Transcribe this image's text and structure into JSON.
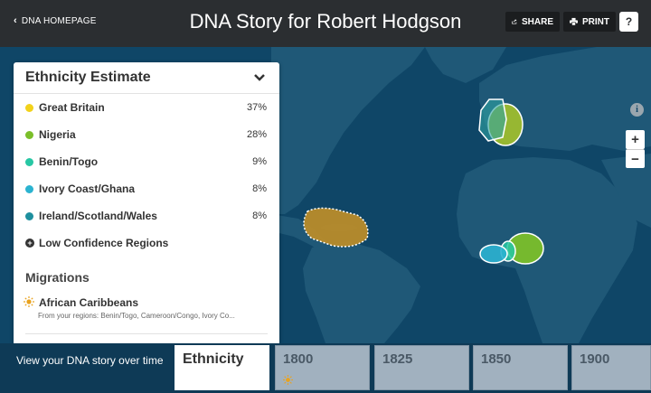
{
  "header": {
    "back_label": "DNA HOMEPAGE",
    "title": "DNA Story for Robert Hodgson",
    "share_label": "SHARE",
    "print_label": "PRINT",
    "help_label": "?"
  },
  "panel": {
    "title": "Ethnicity Estimate",
    "ethnicities": [
      {
        "name": "Great Britain",
        "percent": "37%",
        "color": "#f2d21b"
      },
      {
        "name": "Nigeria",
        "percent": "28%",
        "color": "#7bbf2a"
      },
      {
        "name": "Benin/Togo",
        "percent": "9%",
        "color": "#27c7a4"
      },
      {
        "name": "Ivory Coast/Ghana",
        "percent": "8%",
        "color": "#2bb3d0"
      },
      {
        "name": "Ireland/Scotland/Wales",
        "percent": "8%",
        "color": "#1e8f9e"
      }
    ],
    "low_confidence_label": "Low Confidence Regions",
    "migrations_title": "Migrations",
    "migration": {
      "name": "African Caribbeans",
      "subtitle": "From your regions: Benin/Togo, Cameroon/Congo, Ivory Co..."
    }
  },
  "map": {
    "zoom_in": "+",
    "zoom_out": "−",
    "info": "i"
  },
  "timeline": {
    "label": "View your DNA story over time",
    "tabs": [
      "Ethnicity",
      "1800",
      "1825",
      "1850",
      "1900"
    ]
  }
}
